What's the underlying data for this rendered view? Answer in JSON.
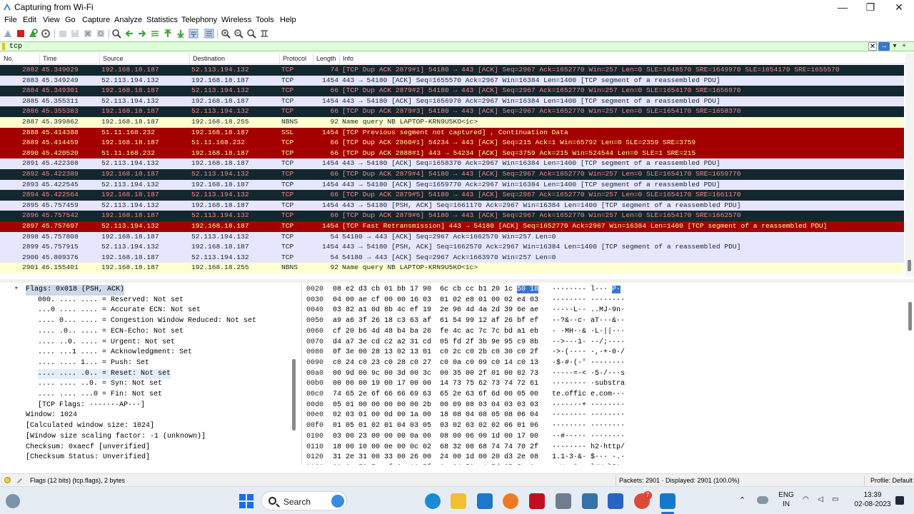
{
  "window": {
    "title": "Capturing from Wi-Fi",
    "minimize_glyph": "—",
    "maximize_glyph": "❐",
    "close_glyph": "✕"
  },
  "menu": [
    "File",
    "Edit",
    "View",
    "Go",
    "Capture",
    "Analyze",
    "Statistics",
    "Telephony",
    "Wireless",
    "Tools",
    "Help"
  ],
  "toolbar": {
    "icons": [
      "shark-fin-icon",
      "stop-capture-icon",
      "restart-capture-icon",
      "capture-options-icon",
      "open-file-icon",
      "save-file-icon",
      "close-file-icon",
      "reload-file-icon",
      "find-packet-icon",
      "go-back-icon",
      "go-forward-icon",
      "go-to-packet-icon",
      "go-first-icon",
      "go-last-icon",
      "autoscroll-icon",
      "colorize-icon",
      "zoom-in-icon",
      "zoom-out-icon",
      "normal-size-icon",
      "resize-columns-icon"
    ],
    "colors": {
      "shark": "#4979c6",
      "stop": "#d11f1f",
      "restart": "#3aa83a",
      "nav": "#4a9e3a"
    }
  },
  "filter": {
    "value": "tcp",
    "clear_glyph": "✕",
    "apply_glyph": "→",
    "dropdown_glyph": "▾",
    "add_glyph": "+"
  },
  "packet_list": {
    "columns": [
      "No.",
      "Time",
      "Source",
      "Destination",
      "Protocol",
      "Length",
      "Info"
    ],
    "rows": [
      {
        "no": "2882",
        "time": "45.349029",
        "src": "192.168.18.187",
        "dst": "52.113.194.132",
        "proto": "TCP",
        "len": "74",
        "info": "[TCP Dup ACK 2879#1] 54180 → 443 [ACK] Seq=2967 Ack=1652770 Win=257 Len=0 SLE=1648570 SRE=1649970 SLE=1654170 SRE=1655570",
        "style": "r-bad"
      },
      {
        "no": "2883",
        "time": "45.349249",
        "src": "52.113.194.132",
        "dst": "192.168.18.187",
        "proto": "TCP",
        "len": "1454",
        "info": "443 → 54180 [ACK] Seq=1655570 Ack=2967 Win=16384 Len=1400 [TCP segment of a reassembled PDU]",
        "style": "r-tcp"
      },
      {
        "no": "2884",
        "time": "45.349301",
        "src": "192.168.18.187",
        "dst": "52.113.194.132",
        "proto": "TCP",
        "len": "66",
        "info": "[TCP Dup ACK 2879#2] 54180 → 443 [ACK] Seq=2967 Ack=1652770 Win=257 Len=0 SLE=1654170 SRE=1656970",
        "style": "r-bad"
      },
      {
        "no": "2885",
        "time": "45.355311",
        "src": "52.113.194.132",
        "dst": "192.168.18.187",
        "proto": "TCP",
        "len": "1454",
        "info": "443 → 54180 [ACK] Seq=1656970 Ack=2967 Win=16384 Len=1400 [TCP segment of a reassembled PDU]",
        "style": "r-tcp"
      },
      {
        "no": "2886",
        "time": "45.355383",
        "src": "192.168.18.187",
        "dst": "52.113.194.132",
        "proto": "TCP",
        "len": "66",
        "info": "[TCP Dup ACK 2879#3] 54180 → 443 [ACK] Seq=2967 Ack=1652770 Win=257 Len=0 SLE=1654170 SRE=1658370",
        "style": "r-bad"
      },
      {
        "no": "2887",
        "time": "45.399862",
        "src": "192.168.18.187",
        "dst": "192.168.18.255",
        "proto": "NBNS",
        "len": "92",
        "info": "Name query NB LAPTOP-KRN9U5KO<1c>",
        "style": "r-nbns"
      },
      {
        "no": "2888",
        "time": "45.414388",
        "src": "51.11.168.232",
        "dst": "192.168.18.187",
        "proto": "SSL",
        "len": "1454",
        "info": "[TCP Previous segment not captured] , Continuation Data",
        "style": "r-ssl"
      },
      {
        "no": "2889",
        "time": "45.414459",
        "src": "192.168.18.187",
        "dst": "51.11.168.232",
        "proto": "TCP",
        "len": "66",
        "info": "[TCP Dup ACK 2860#1] 54234 → 443 [ACK] Seq=215 Ack=1 Win=65792 Len=0 SLE=2359 SRE=3759",
        "style": "r-dark"
      },
      {
        "no": "2890",
        "time": "45.420520",
        "src": "51.11.168.232",
        "dst": "192.168.18.187",
        "proto": "TCP",
        "len": "66",
        "info": "[TCP Dup ACK 2888#1] 443 → 54234 [ACK] Seq=3759 Ack=215 Win=524544 Len=0 SLE=1 SRE=215",
        "style": "r-dark"
      },
      {
        "no": "2891",
        "time": "45.422308",
        "src": "52.113.194.132",
        "dst": "192.168.18.187",
        "proto": "TCP",
        "len": "1454",
        "info": "443 → 54180 [ACK] Seq=1658370 Ack=2967 Win=16384 Len=1400 [TCP segment of a reassembled PDU]",
        "style": "r-tcp"
      },
      {
        "no": "2892",
        "time": "45.422389",
        "src": "192.168.18.187",
        "dst": "52.113.194.132",
        "proto": "TCP",
        "len": "66",
        "info": "[TCP Dup ACK 2879#4] 54180 → 443 [ACK] Seq=2967 Ack=1652770 Win=257 Len=0 SLE=1654170 SRE=1659770",
        "style": "r-bad"
      },
      {
        "no": "2893",
        "time": "45.422545",
        "src": "52.113.194.132",
        "dst": "192.168.18.187",
        "proto": "TCP",
        "len": "1454",
        "info": "443 → 54180 [ACK] Seq=1659770 Ack=2967 Win=16384 Len=1400 [TCP segment of a reassembled PDU]",
        "style": "r-tcp"
      },
      {
        "no": "2894",
        "time": "45.422564",
        "src": "192.168.18.187",
        "dst": "52.113.194.132",
        "proto": "TCP",
        "len": "66",
        "info": "[TCP Dup ACK 2879#5] 54180 → 443 [ACK] Seq=2967 Ack=1652770 Win=257 Len=0 SLE=1654170 SRE=1661170",
        "style": "r-bad"
      },
      {
        "no": "2895",
        "time": "45.757459",
        "src": "52.113.194.132",
        "dst": "192.168.18.187",
        "proto": "TCP",
        "len": "1454",
        "info": "443 → 54180 [PSH, ACK] Seq=1661170 Ack=2967 Win=16384 Len=1400 [TCP segment of a reassembled PDU]",
        "style": "r-tcp"
      },
      {
        "no": "2896",
        "time": "45.757542",
        "src": "192.168.18.187",
        "dst": "52.113.194.132",
        "proto": "TCP",
        "len": "66",
        "info": "[TCP Dup ACK 2879#6] 54180 → 443 [ACK] Seq=2967 Ack=1652770 Win=257 Len=0 SLE=1654170 SRE=1662570",
        "style": "r-bad"
      },
      {
        "no": "2897",
        "time": "45.757697",
        "src": "52.113.194.132",
        "dst": "192.168.18.187",
        "proto": "TCP",
        "len": "1454",
        "info": "[TCP Fast Retransmission] 443 → 54180 [ACK] Seq=1652770 Ack=2967 Win=16384 Len=1400 [TCP segment of a reassembled PDU]",
        "style": "r-dark"
      },
      {
        "no": "2898",
        "time": "45.757808",
        "src": "192.168.18.187",
        "dst": "52.113.194.132",
        "proto": "TCP",
        "len": "54",
        "info": "54180 → 443 [ACK] Seq=2967 Ack=1662570 Win=257 Len=0",
        "style": "r-tcp"
      },
      {
        "no": "2899",
        "time": "45.757915",
        "src": "52.113.194.132",
        "dst": "192.168.18.187",
        "proto": "TCP",
        "len": "1454",
        "info": "443 → 54180 [PSH, ACK] Seq=1662570 Ack=2967 Win=16384 Len=1400 [TCP segment of a reassembled PDU]",
        "style": "r-tcp"
      },
      {
        "no": "2900",
        "time": "45.809376",
        "src": "192.168.18.187",
        "dst": "52.113.194.132",
        "proto": "TCP",
        "len": "54",
        "info": "54180 → 443 [ACK] Seq=2967 Ack=1663970 Win=257 Len=0",
        "style": "r-tcp"
      },
      {
        "no": "2901",
        "time": "46.155401",
        "src": "192.168.18.187",
        "dst": "192.168.18.255",
        "proto": "NBNS",
        "len": "92",
        "info": "Name query NB LAPTOP-KRN9U5KO<1c>",
        "style": "r-nbns"
      }
    ]
  },
  "detail_tree": {
    "expand_glyph": "▾",
    "lines": [
      {
        "text": "Flags: 0x018 (PSH, ACK)",
        "indent": 36,
        "state": "selected"
      },
      {
        "text": "000. .... .... = Reserved: Not set",
        "indent": 53,
        "state": ""
      },
      {
        "text": "...0 .... .... = Accurate ECN: Not set",
        "indent": 53,
        "state": ""
      },
      {
        "text": ".... 0... .... = Congestion Window Reduced: Not set",
        "indent": 53,
        "state": ""
      },
      {
        "text": ".... .0.. .... = ECN-Echo: Not set",
        "indent": 53,
        "state": ""
      },
      {
        "text": ".... ..0. .... = Urgent: Not set",
        "indent": 53,
        "state": ""
      },
      {
        "text": ".... ...1 .... = Acknowledgment: Set",
        "indent": 53,
        "state": ""
      },
      {
        "text": ".... .... 1... = Push: Set",
        "indent": 53,
        "state": ""
      },
      {
        "text": ".... .... .0.. = Reset: Not set",
        "indent": 53,
        "state": "hl"
      },
      {
        "text": ".... .... ..0. = Syn: Not set",
        "indent": 53,
        "state": ""
      },
      {
        "text": ".... .... ...0 = Fin: Not set",
        "indent": 53,
        "state": ""
      },
      {
        "text": "[TCP Flags: ·······AP···]",
        "indent": 53,
        "state": ""
      },
      {
        "text": "Window: 1024",
        "indent": 36,
        "state": ""
      },
      {
        "text": "[Calculated window size: 1024]",
        "indent": 36,
        "state": ""
      },
      {
        "text": "[Window size scaling factor: -1 (unknown)]",
        "indent": 36,
        "state": ""
      },
      {
        "text": "Checksum: 0xaecf [unverified]",
        "indent": 36,
        "state": ""
      },
      {
        "text": "[Checksum Status: Unverified]",
        "indent": 36,
        "state": ""
      }
    ]
  },
  "hex": {
    "lines": [
      {
        "off": "0020",
        "hex_a": "08 e2 d3 cb 01 bb 17 90  6c cb cc b1 20 1c ",
        "hex_sel": "50 18",
        "asc_a": "········ l··· ",
        "asc_sel": "P·"
      },
      {
        "off": "0030",
        "hex_a": "04 00 ae cf 00 00 16 03  01 02 e8 01 00 02 e4 03",
        "hex_sel": "",
        "asc_a": "········ ········",
        "asc_sel": ""
      },
      {
        "off": "0040",
        "hex_a": "03 82 a1 0d 8b 4c ef 19  2e 96 4d 4a 2d 39 6e ae",
        "hex_sel": "",
        "asc_a": "·····L·· ..MJ-9n·",
        "asc_sel": ""
      },
      {
        "off": "0050",
        "hex_a": "a9 a6 3f 26 18 c3 63 af  61 54 99 12 af 26 bf ef",
        "hex_sel": "",
        "asc_a": "··?&··c· aT···&··",
        "asc_sel": ""
      },
      {
        "off": "0060",
        "hex_a": "cf 20 b6 4d 48 b4 ba 26  fe 4c ac 7c 7c bd a1 eb",
        "hex_sel": "",
        "asc_a": "· ·MH··& ·L·||···",
        "asc_sel": ""
      },
      {
        "off": "0070",
        "hex_a": "d4 a7 3e cd c2 a2 31 cd  05 fd 2f 3b 9e 95 c9 8b",
        "hex_sel": "",
        "asc_a": "··>···1· ··/;····",
        "asc_sel": ""
      },
      {
        "off": "0080",
        "hex_a": "0f 3e 00 28 13 02 13 01  c0 2c c0 2b c0 30 c0 2f",
        "hex_sel": "",
        "asc_a": "·>·(···· ·,·+·0·/",
        "asc_sel": ""
      },
      {
        "off": "0090",
        "hex_a": "c0 24 c0 23 c0 28 c0 27  c0 0a c0 09 c0 14 c0 13",
        "hex_sel": "",
        "asc_a": "·$·#·(·' ········",
        "asc_sel": ""
      },
      {
        "off": "00a0",
        "hex_a": "00 9d 00 9c 00 3d 00 3c  00 35 00 2f 01 00 02 73",
        "hex_sel": "",
        "asc_a": "·····=·< ·5·/···s",
        "asc_sel": ""
      },
      {
        "off": "00b0",
        "hex_a": "00 00 00 19 00 17 00 00  14 73 75 62 73 74 72 61",
        "hex_sel": "",
        "asc_a": "········ ·substra",
        "asc_sel": ""
      },
      {
        "off": "00c0",
        "hex_a": "74 65 2e 6f 66 66 69 63  65 2e 63 6f 6d 00 05 00",
        "hex_sel": "",
        "asc_a": "te.offic e.com···",
        "asc_sel": ""
      },
      {
        "off": "00d0",
        "hex_a": "05 01 00 00 00 00 00 2b  00 09 08 03 04 03 03 03",
        "hex_sel": "",
        "asc_a": "·······+ ········",
        "asc_sel": ""
      },
      {
        "off": "00e0",
        "hex_a": "02 03 01 00 0d 00 1a 00  18 08 04 08 05 08 06 04",
        "hex_sel": "",
        "asc_a": "········ ········",
        "asc_sel": ""
      },
      {
        "off": "00f0",
        "hex_a": "01 05 01 02 01 04 03 05  03 02 03 02 02 06 01 06",
        "hex_sel": "",
        "asc_a": "········ ········",
        "asc_sel": ""
      },
      {
        "off": "0100",
        "hex_a": "03 00 23 00 00 00 0a 00  08 00 06 00 1d 00 17 00",
        "hex_sel": "",
        "asc_a": "··#····· ········",
        "asc_sel": ""
      },
      {
        "off": "0110",
        "hex_a": "18 00 10 00 0e 00 0c 02  68 32 08 68 74 74 70 2f",
        "hex_sel": "",
        "asc_a": "········ h2·http/",
        "asc_sel": ""
      },
      {
        "off": "0120",
        "hex_a": "31 2e 31 00 33 00 26 00  24 00 1d 00 20 d3 2e 08",
        "hex_sel": "",
        "asc_a": "1.1·3·&· $··· ·.·",
        "asc_sel": ""
      },
      {
        "off": "0130",
        "hex_a": "80 8c 59 7e cf 2a 16 7f  6c 34 59 e4 7d 35 5e 9c",
        "hex_sel": "",
        "asc_a": "··Y~·*·· l4Y·}5^·",
        "asc_sel": ""
      },
      {
        "off": "0140",
        "hex_a": "b2 aa 99 5a 38 85 8c bf  72 7c 60 73 50 00 31 00",
        "hex_sel": "",
        "asc_a": "···Z8··· r|`sP·1·",
        "asc_sel": ""
      }
    ]
  },
  "status": {
    "field_info": "Flags (12 bits) (tcp.flags), 2 bytes",
    "packets": "Packets: 2901 · Displayed: 2901 (100.0%)",
    "profile": "Profile: Default"
  },
  "taskbar": {
    "search_label": "Search",
    "lang_top": "ENG",
    "lang_bottom": "IN",
    "clock_time": "13:39",
    "clock_date": "02-08-2023",
    "chrome_badge": "7",
    "apps": [
      "widgets-icon",
      "windows-start-icon",
      "copilot-icon",
      "edge-icon",
      "file-explorer-icon",
      "wireshark-alt-icon",
      "firefox-icon",
      "mcafee-icon",
      "camera-icon",
      "python-icon",
      "store-icon",
      "chrome-icon",
      "wireshark-icon"
    ]
  }
}
